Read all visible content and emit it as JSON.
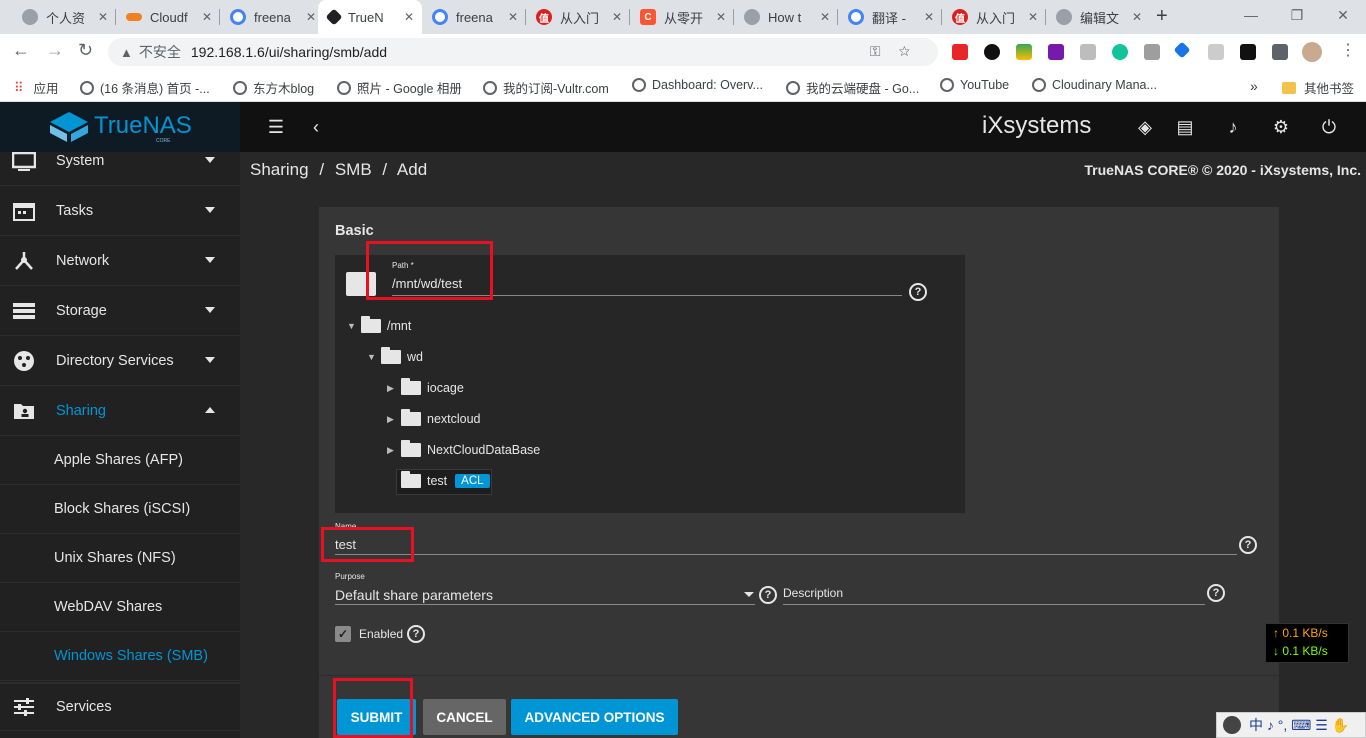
{
  "browser": {
    "tabs": [
      {
        "title": "个人资",
        "color": "#9aa0a6"
      },
      {
        "title": "Cloudf",
        "color": "#f38020"
      },
      {
        "title": "freena",
        "color": "#4285f4"
      },
      {
        "title": "TrueN",
        "color": "#202124"
      },
      {
        "title": "freena",
        "color": "#4285f4"
      },
      {
        "title": "从入门",
        "color": "#e02020"
      },
      {
        "title": "从零开",
        "color": "#fc5531"
      },
      {
        "title": "How t",
        "color": "#9aa0a6"
      },
      {
        "title": "翻译 -",
        "color": "#4285f4"
      },
      {
        "title": "从入门",
        "color": "#e02020"
      },
      {
        "title": "编辑文",
        "color": "#9aa0a6"
      }
    ],
    "new_tab": "+",
    "address": {
      "security_label": "不安全",
      "url": "192.168.1.6/ui/sharing/smb/add"
    },
    "bookmarks": [
      "应用",
      "(16 条消息) 首页 -...",
      "东方木blog",
      "照片 - Google 相册",
      "我的订阅-Vultr.com",
      "Dashboard: Overv...",
      "我的云端硬盘 - Go...",
      "YouTube",
      "Cloudinary Mana..."
    ],
    "bookmarks_more": "»",
    "other_bookmarks": "其他书签"
  },
  "app": {
    "brand": "TrueNAS",
    "brand_sub": "CORE",
    "vendor_logo": "iXsystems",
    "topbar_icons": [
      "menu-icon",
      "back-icon",
      "truecommand-icon",
      "clipboard-icon",
      "bell-icon",
      "gear-icon",
      "power-icon"
    ]
  },
  "sidebar": {
    "items": [
      {
        "label": "System",
        "icon": "monitor-icon"
      },
      {
        "label": "Tasks",
        "icon": "calendar-icon"
      },
      {
        "label": "Network",
        "icon": "network-icon"
      },
      {
        "label": "Storage",
        "icon": "storage-icon"
      },
      {
        "label": "Directory Services",
        "icon": "directory-icon"
      },
      {
        "label": "Sharing",
        "icon": "sharing-icon"
      }
    ],
    "sharing_children": [
      "Apple Shares (AFP)",
      "Block Shares (iSCSI)",
      "Unix Shares (NFS)",
      "WebDAV Shares",
      "Windows Shares (SMB)"
    ],
    "services": "Services",
    "active_color": "#0095d5"
  },
  "breadcrumb": {
    "a": "Sharing",
    "b": "SMB",
    "c": "Add",
    "sep": "/"
  },
  "copyright": "TrueNAS CORE® © 2020 - iXsystems, Inc.",
  "form": {
    "section": "Basic",
    "path_label": "Path *",
    "path_value": "/mnt/wd/test",
    "tree": {
      "root": "/mnt",
      "wd": "wd",
      "children": [
        "iocage",
        "nextcloud",
        "NextCloudDataBase"
      ],
      "selected": "test",
      "badge": "ACL"
    },
    "name_label": "Name",
    "name_value": "test",
    "purpose_label": "Purpose",
    "purpose_value": "Default share parameters",
    "description_label": "Description",
    "enabled_label": "Enabled",
    "buttons": {
      "submit": "SUBMIT",
      "cancel": "CANCEL",
      "advanced": "ADVANCED OPTIONS"
    }
  },
  "netspeed": {
    "up": "↑ 0.1 KB/s",
    "down": "↓ 0.1 KB/s"
  },
  "ime": "中 ♪ °, ⌨ ☰ ✋"
}
